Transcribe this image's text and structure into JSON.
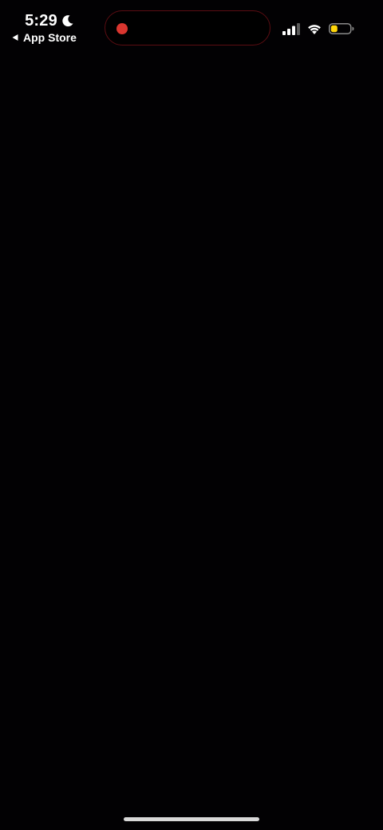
{
  "status_bar": {
    "time": "5:29",
    "back_label": "App Store",
    "icons": {
      "moon": "moon-icon",
      "back": "back-arrow-icon",
      "signal": "cellular-signal-icon",
      "wifi": "wifi-icon",
      "battery": "battery-icon"
    },
    "battery_level": 0.35,
    "battery_color": "#ffd60a",
    "recording_dot_color": "#d9362f",
    "island_border_color": "#5b0d12"
  },
  "background_color": "#020103",
  "home_indicator_color": "#d8d8d8"
}
